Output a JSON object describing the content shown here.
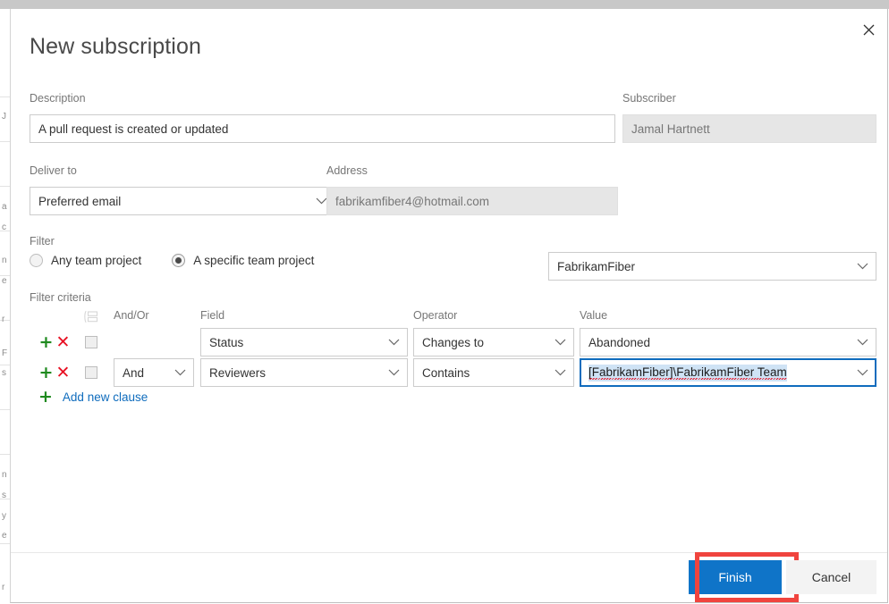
{
  "dialog": {
    "title": "New subscription",
    "close_icon": "close-icon"
  },
  "description": {
    "label": "Description",
    "value": "A pull request is created or updated"
  },
  "subscriber": {
    "label": "Subscriber",
    "value": "Jamal Hartnett"
  },
  "deliver_to": {
    "label": "Deliver to",
    "value": "Preferred email"
  },
  "address": {
    "label": "Address",
    "value": "fabrikamfiber4@hotmail.com"
  },
  "filter": {
    "label": "Filter",
    "options": [
      {
        "label": "Any team project",
        "checked": false
      },
      {
        "label": "A specific team project",
        "checked": true
      }
    ],
    "project_value": "FabrikamFiber"
  },
  "filter_criteria": {
    "label": "Filter criteria",
    "group_icon": "group-clause-icon",
    "columns": {
      "and_or": "And/Or",
      "field": "Field",
      "operator": "Operator",
      "value": "Value"
    },
    "add_clause_label": "Add new clause",
    "add_icon": "plus-icon",
    "row_add_icon": "plus-icon",
    "row_delete_icon": "close-x-icon",
    "rows": [
      {
        "and_or": "",
        "field": "Status",
        "operator": "Changes to",
        "value": "Abandoned",
        "value_focused": false,
        "checked": false
      },
      {
        "and_or": "And",
        "field": "Reviewers",
        "operator": "Contains",
        "value": "[FabrikamFiber]\\FabrikamFiber Team",
        "value_focused": true,
        "checked": false
      }
    ]
  },
  "footer": {
    "finish_label": "Finish",
    "cancel_label": "Cancel"
  },
  "colors": {
    "accent_blue": "#0f74c8",
    "link_blue": "#0f6cbd",
    "add_green": "#1f8a1f",
    "delete_red": "#e81123",
    "highlight_red": "#f0443e",
    "selection_blue": "#cfe3f5",
    "disabled_gray": "#e6e6e6",
    "label_gray": "#767676"
  },
  "backdrop": {
    "fragments": [
      "J",
      "a",
      "c",
      "n",
      "e",
      "r",
      "F",
      "s",
      "n",
      "s",
      "y",
      "e",
      "r"
    ]
  }
}
